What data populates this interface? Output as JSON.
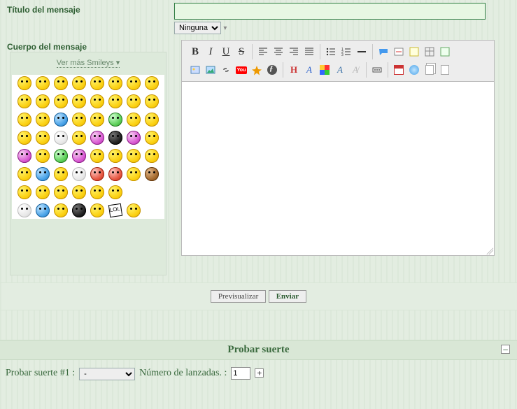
{
  "labels": {
    "title": "Título del mensaje",
    "body": "Cuerpo del mensaje",
    "more_smileys": "Ver más Smileys ▾",
    "preview": "Previsualizar",
    "send": "Enviar"
  },
  "fields": {
    "title_value": "",
    "font_select": "Ninguna",
    "body_value": ""
  },
  "luck": {
    "heading": "Probar suerte",
    "row_label": "Probar suerte #1 :",
    "select_value": "-",
    "throws_label": "Número de lanzadas. :",
    "throws_value": "1"
  },
  "toolbar": {
    "r1": [
      [
        "bold",
        "italic",
        "underline",
        "strike"
      ],
      [
        "align-left",
        "align-center",
        "align-right",
        "align-justify"
      ],
      [
        "list-ul",
        "list-ol",
        "hr"
      ],
      [
        "quote",
        "spoiler",
        "code",
        "table-wrap",
        "wrap-icon"
      ]
    ],
    "r2": [
      [
        "host-image",
        "insert-image",
        "link",
        "youtube",
        "flash",
        "flash2"
      ],
      [
        "headers",
        "font-color",
        "color-pick",
        "font-family",
        "clear-format"
      ],
      [
        "more"
      ],
      [
        "calendar",
        "globe",
        "copy-page",
        "page"
      ]
    ]
  },
  "smileys": {
    "colors": [
      "y",
      "y",
      "y",
      "y",
      "y",
      "y",
      "y",
      "y",
      "y",
      "y",
      "y",
      "y",
      "y",
      "y",
      "y",
      "y",
      "y",
      "y",
      "b",
      "y",
      "y",
      "g",
      "y",
      "y",
      "y",
      "y",
      "w",
      "y",
      "p",
      "k",
      "p",
      "y",
      "p",
      "y",
      "g",
      "p",
      "y",
      "y",
      "y",
      "y",
      "y",
      "b",
      "y",
      "w",
      "r",
      "r",
      "y",
      "br",
      "y",
      "y",
      "y",
      "y",
      "y",
      "y",
      "",
      "",
      "w",
      "b",
      "y",
      "k",
      "y",
      "lol",
      "y",
      ""
    ]
  }
}
